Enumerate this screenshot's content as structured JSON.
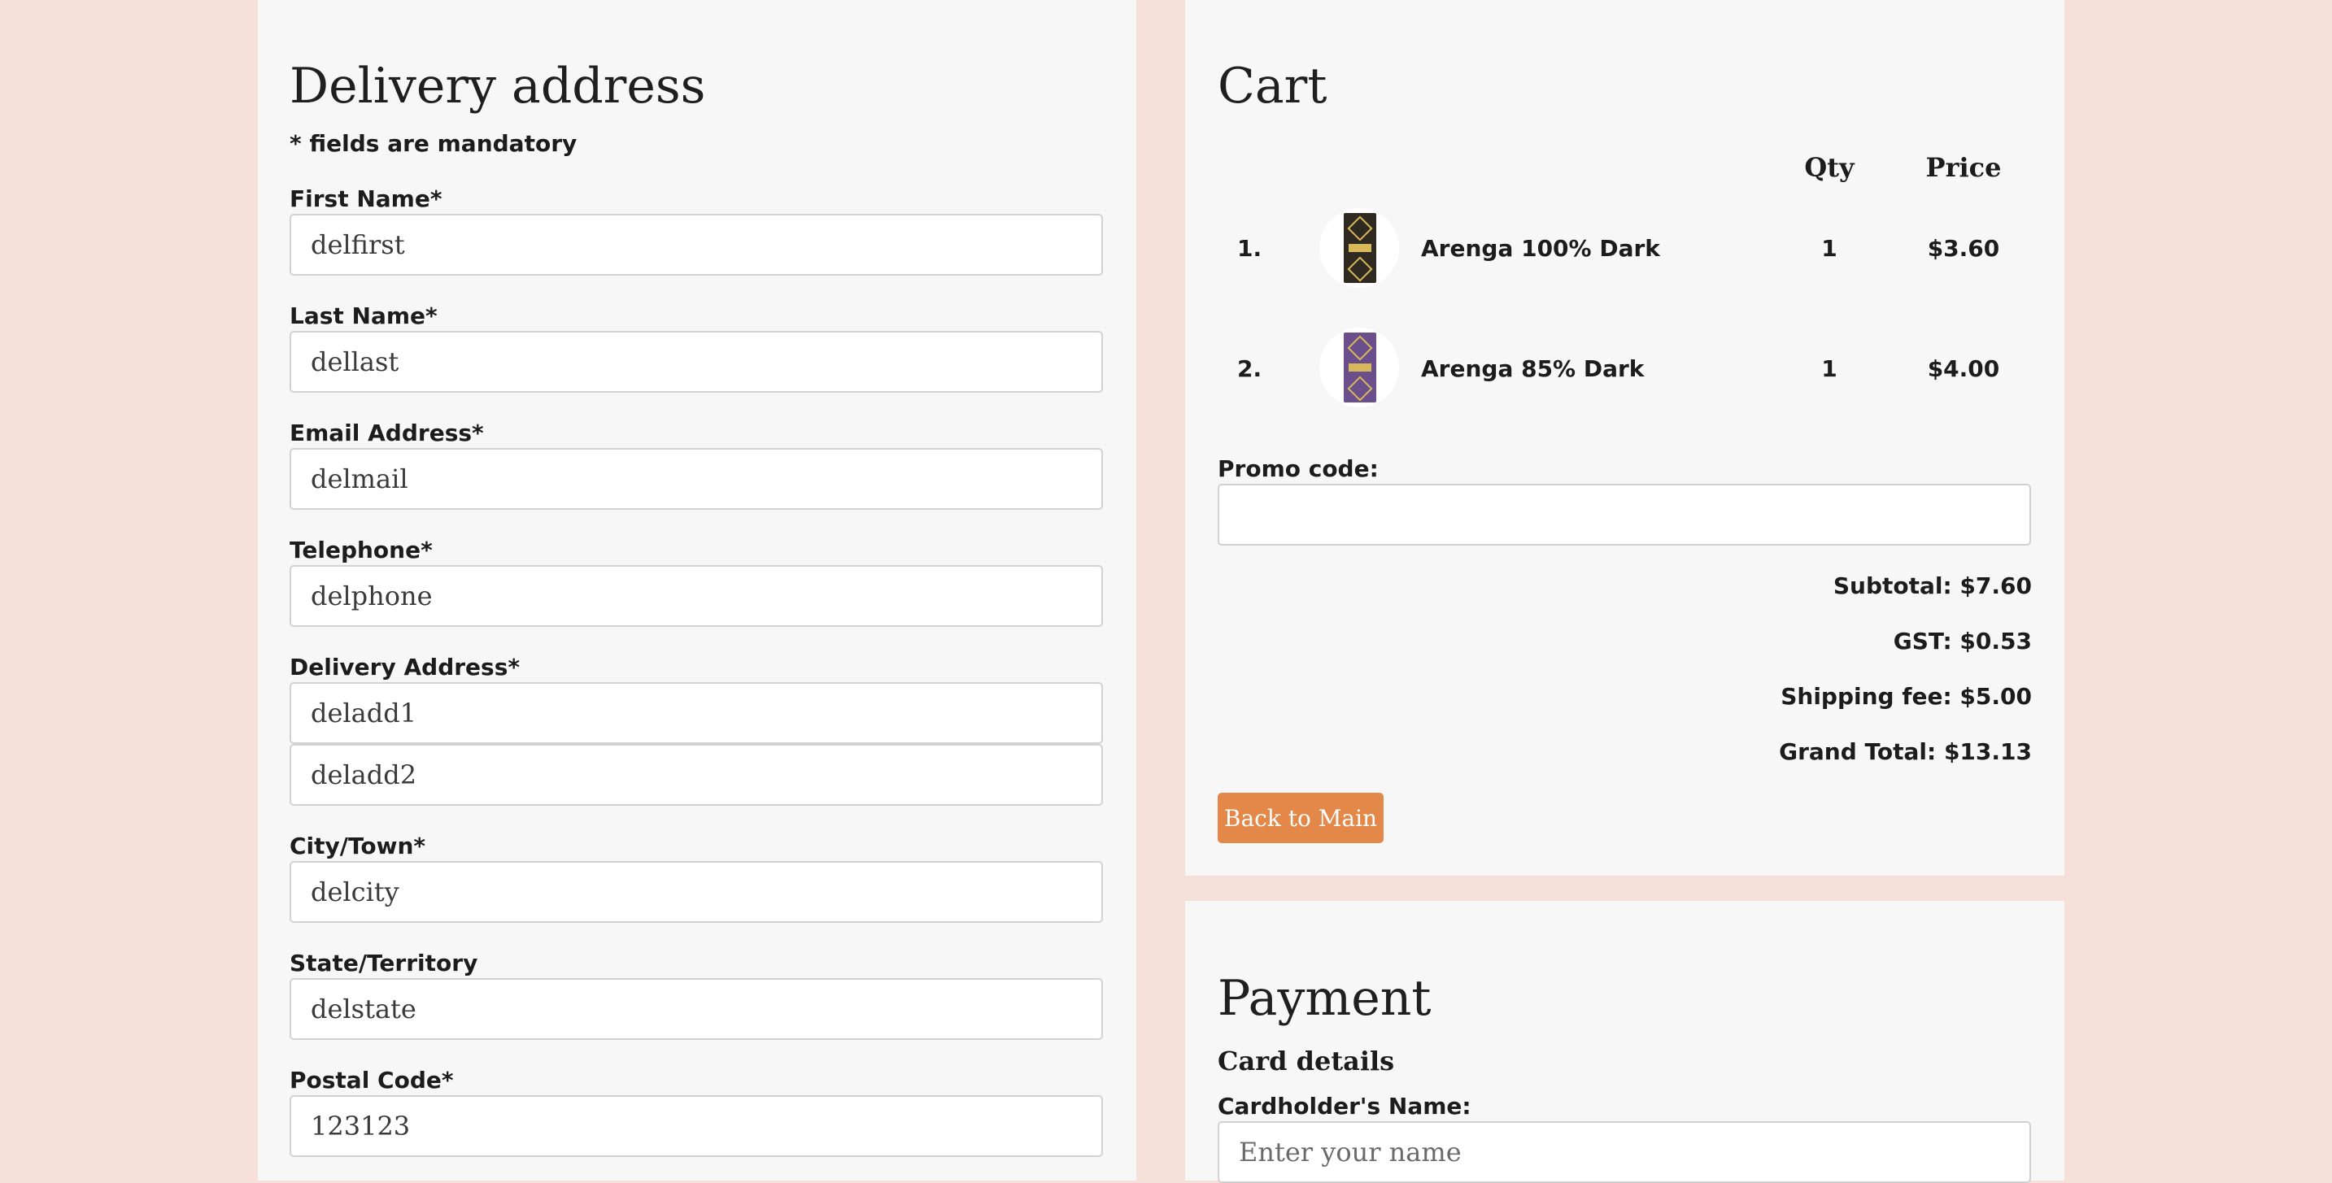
{
  "delivery": {
    "title": "Delivery address",
    "mandatory_note": "* fields are mandatory",
    "first_name": {
      "label": "First Name*",
      "value": "delfirst"
    },
    "last_name": {
      "label": "Last Name*",
      "value": "dellast"
    },
    "email": {
      "label": "Email Address*",
      "value": "delmail"
    },
    "telephone": {
      "label": "Telephone*",
      "value": "delphone"
    },
    "address": {
      "label": "Delivery Address*",
      "line1": "deladd1",
      "line2": "deladd2"
    },
    "city": {
      "label": "City/Town*",
      "value": "delcity"
    },
    "state": {
      "label": "State/Territory",
      "value": "delstate"
    },
    "postal": {
      "label": "Postal Code*",
      "value": "123123"
    }
  },
  "cart": {
    "title": "Cart",
    "columns": {
      "qty": "Qty",
      "price": "Price"
    },
    "items": [
      {
        "index": "1.",
        "name": "Arenga 100% Dark",
        "qty": "1",
        "price": "$3.60",
        "wrapper_color": "#2e2a22"
      },
      {
        "index": "2.",
        "name": "Arenga 85% Dark",
        "qty": "1",
        "price": "$4.00",
        "wrapper_color": "#6a4f8c"
      }
    ],
    "promo": {
      "label": "Promo code:",
      "value": ""
    },
    "subtotal": "Subtotal: $7.60",
    "gst": "GST: $0.53",
    "shipping": "Shipping fee: $5.00",
    "grand_total": "Grand Total: $13.13",
    "back_button": "Back to Main"
  },
  "payment": {
    "title": "Payment",
    "card_details": "Card details",
    "cardholder": {
      "label": "Cardholder's Name:",
      "placeholder": "Enter your name"
    }
  },
  "colors": {
    "page_background": "#f5e0da",
    "panel_background": "#f7f7f7",
    "accent_button": "#e38848"
  }
}
